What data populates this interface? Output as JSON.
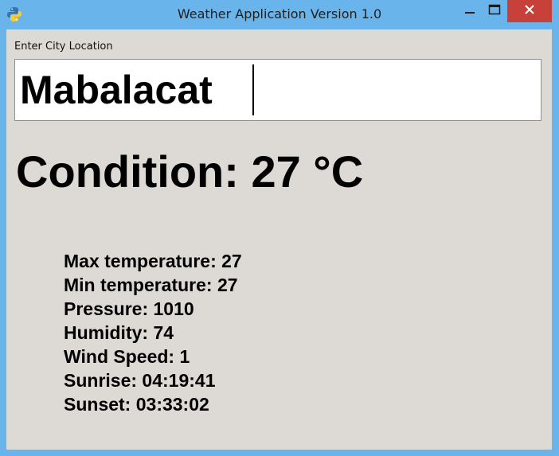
{
  "window": {
    "title": "Weather Application Version 1.0",
    "icon": "python-icon",
    "controls": {
      "minimize_icon": "minimize-icon",
      "maximize_icon": "maximize-icon",
      "close_icon": "close-icon"
    }
  },
  "colors": {
    "titlebar": "#6ab4ec",
    "client_bg": "#dddad5",
    "close_button": "#c7403a"
  },
  "form": {
    "city_label": "Enter City Location",
    "city_value": "Mabalacat"
  },
  "weather": {
    "condition": "Condition: 27 °C",
    "details": [
      "Max temperature: 27",
      "Min temperature: 27",
      "Pressure: 1010",
      "Humidity: 74",
      "Wind Speed: 1",
      "Sunrise: 04:19:41",
      "Sunset: 03:33:02"
    ]
  }
}
